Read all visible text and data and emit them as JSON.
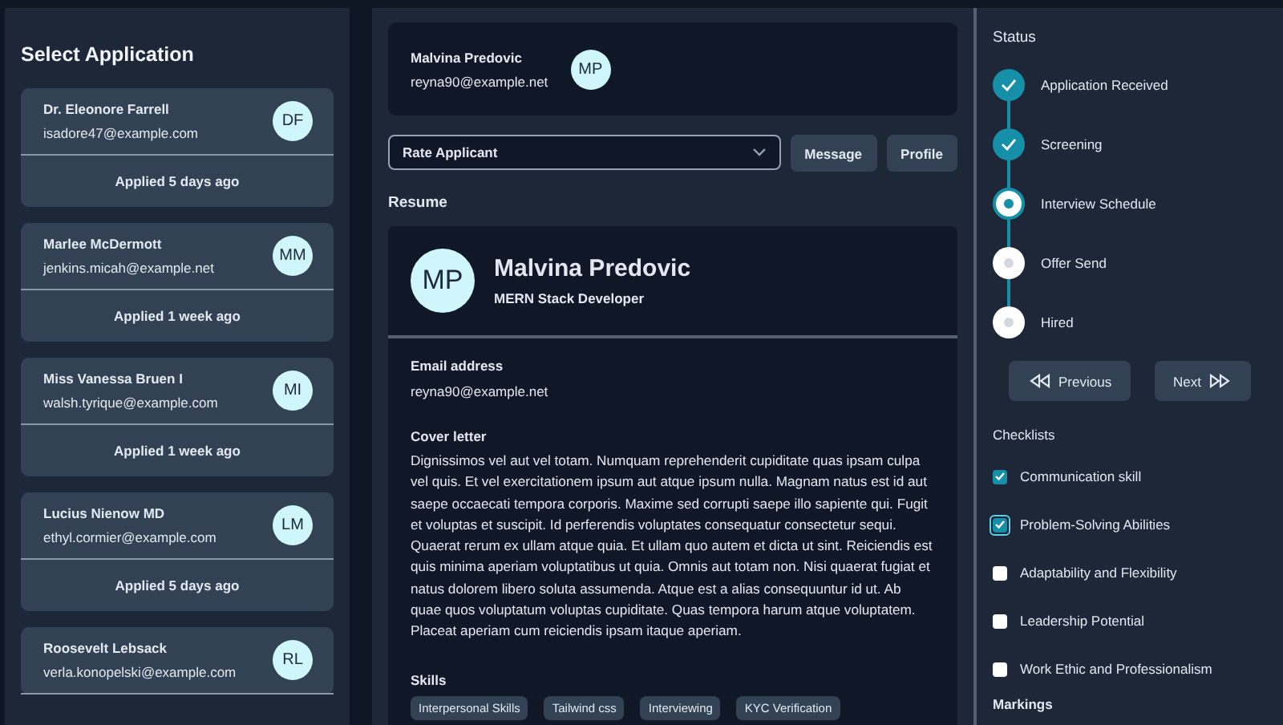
{
  "applications": {
    "title": "Select Application",
    "items": [
      {
        "name": "Dr. Eleonore Farrell",
        "email": "isadore47@example.com",
        "initials": "DF",
        "applied": "Applied 5 days ago"
      },
      {
        "name": "Marlee McDermott",
        "email": "jenkins.micah@example.net",
        "initials": "MM",
        "applied": "Applied 1 week ago"
      },
      {
        "name": "Miss Vanessa Bruen I",
        "email": "walsh.tyrique@example.com",
        "initials": "MI",
        "applied": "Applied 1 week ago"
      },
      {
        "name": "Lucius Nienow MD",
        "email": "ethyl.cormier@example.com",
        "initials": "LM",
        "applied": "Applied 5 days ago"
      },
      {
        "name": "Roosevelt Lebsack",
        "email": "verla.konopelski@example.com",
        "initials": "RL"
      }
    ]
  },
  "applicant": {
    "name": "Malvina Predovic",
    "email": "reyna90@example.net",
    "initials": "MP"
  },
  "rate_select": {
    "value": "Rate Applicant"
  },
  "buttons": [
    "Message",
    "Profile"
  ],
  "resume": {
    "title": "Resume",
    "initials": "MP",
    "name": "Malvina Predovic",
    "role": "MERN Stack Developer",
    "email_label": "Email address",
    "email": "reyna90@example.net",
    "cover_label": "Cover letter",
    "cover_letter": "Dignissimos vel aut vel totam. Numquam reprehenderit cupiditate quas ipsam culpa vel quis. Et vel exercitationem ipsum aut atque ipsum nulla. Magnam natus est id aut saepe occaecati tempora corporis. Maxime sed corrupti saepe illo sapiente qui. Fugit et voluptas et suscipit. Id perferendis voluptates consequatur consectetur sequi. Quaerat rerum ex ullam atque quia. Et ullam quo autem et dicta ut sint. Reiciendis est quis minima aperiam voluptatibus ut quia. Omnis aut totam non. Nisi quaerat fugiat et natus dolorem libero soluta assumenda. Atque est a alias consequuntur id ut. Ab quae quos voluptatum voluptas cupiditate. Quas tempora harum atque voluptatem. Placeat aperiam cum reiciendis ipsam itaque aperiam.",
    "skills_label": "Skills",
    "skills": [
      "Interpersonal Skills",
      "Tailwind css",
      "Interviewing",
      "KYC Verification"
    ]
  },
  "status": {
    "title": "Status",
    "steps": [
      {
        "label": "Application Received",
        "completed": true,
        "current": false
      },
      {
        "label": "Screening",
        "completed": true,
        "current": false
      },
      {
        "label": "Interview Schedule",
        "completed": false,
        "current": true
      },
      {
        "label": "Offer Send",
        "completed": false,
        "current": false
      },
      {
        "label": "Hired",
        "completed": false,
        "current": false
      }
    ],
    "previous": "Previous",
    "next": "Next"
  },
  "checklists": {
    "title": "Checklists",
    "items": [
      {
        "label": "Communication skill",
        "checked": true,
        "focused": false
      },
      {
        "label": "Problem-Solving Abilities",
        "checked": true,
        "focused": true
      },
      {
        "label": "Adaptability and Flexibility",
        "checked": false,
        "focused": false
      },
      {
        "label": "Leadership Potential",
        "checked": false,
        "focused": false
      },
      {
        "label": "Work Ethic and Professionalism",
        "checked": false,
        "focused": false
      }
    ]
  },
  "markings": {
    "title": "Markings"
  }
}
